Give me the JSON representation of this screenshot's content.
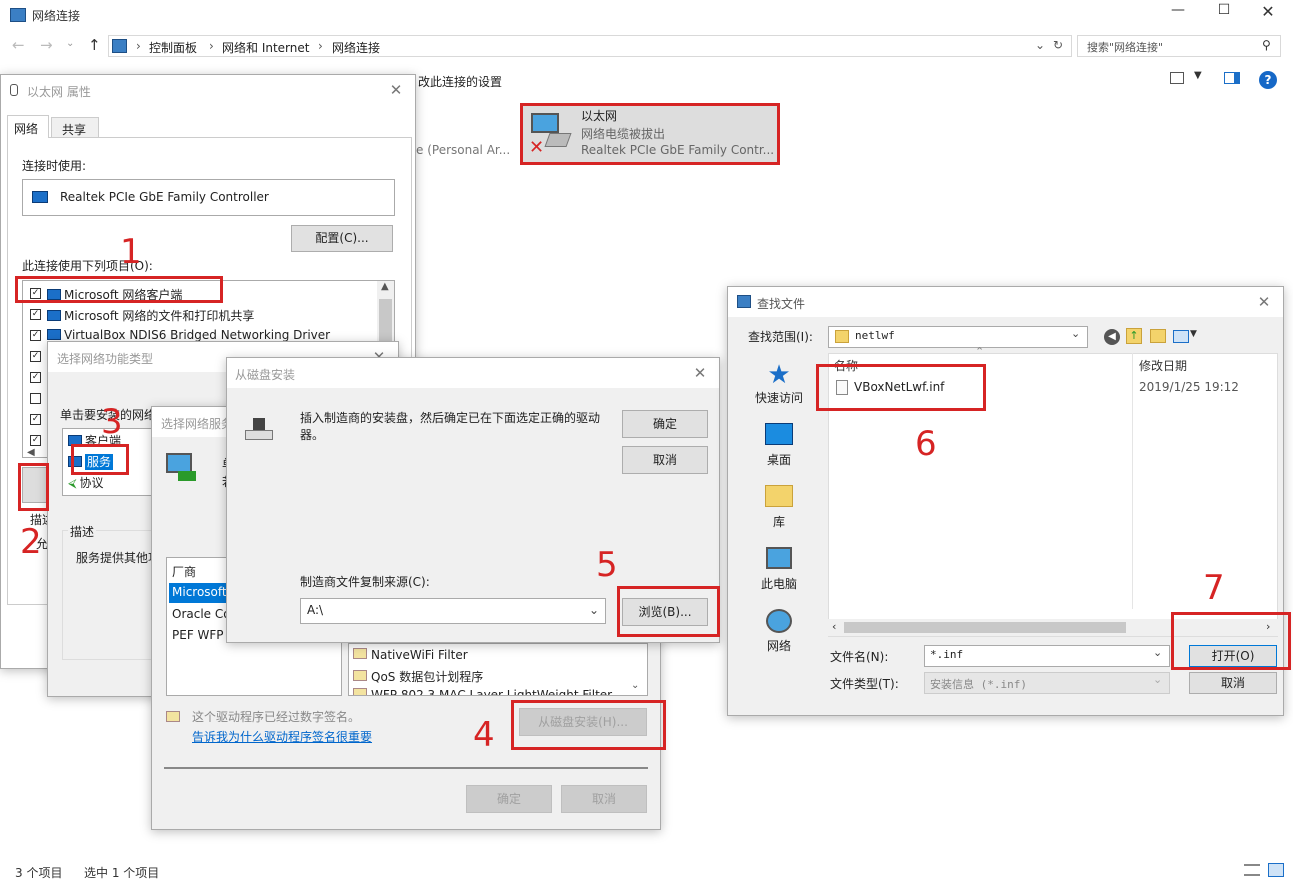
{
  "explorer": {
    "title": "网络连接",
    "crumb1": "控制面板",
    "crumb2": "网络和 Internet",
    "crumb3": "网络连接",
    "search_placeholder": "搜索\"网络连接\"",
    "toolbar_text": "改此连接的设置",
    "partial_item": "e (Personal Ar...",
    "adapter": {
      "name": "以太网",
      "status": "网络电缆被拔出",
      "device": "Realtek PCIe GbE Family Contr..."
    },
    "status_count": "3 个项目",
    "status_selected": "选中 1 个项目"
  },
  "eth_props": {
    "title": "以太网 属性",
    "tab_network": "网络",
    "tab_share": "共享",
    "connect_using": "连接时使用:",
    "adapter": "Realtek PCIe GbE Family Controller",
    "configure": "配置(C)...",
    "items_label": "此连接使用下列项目(O):",
    "items": [
      "Microsoft 网络客户端",
      "Microsoft 网络的文件和打印机共享",
      "VirtualBox NDIS6 Bridged Networking Driver"
    ],
    "desc_short": "描述",
    "desc_char": "允"
  },
  "select_type": {
    "title": "选择网络功能类型",
    "prompt": "单击要安装的网络功能类型",
    "types": [
      "客户端",
      "服务",
      "协议"
    ],
    "desc_label": "描述",
    "desc_text": "服务提供其他功"
  },
  "select_service": {
    "title": "选择网络服务",
    "frag1": "单",
    "frag2": "若",
    "vendor_header": "厂商",
    "vendors": [
      "Microsoft",
      "Oracle Co",
      "PEF WFP"
    ],
    "services": [
      "NativeWiFi Filter",
      "QoS 数据包计划程序",
      "WFP 802.3 MAC Layer LightWeight Filter"
    ],
    "signed": "这个驱动程序已经过数字签名。",
    "why_link": "告诉我为什么驱动程序签名很重要",
    "have_disk": "从磁盘安装(H)...",
    "ok": "确定",
    "cancel": "取消"
  },
  "disk_install": {
    "title": "从磁盘安装",
    "message": "插入制造商的安装盘，然后确定已在下面选定正确的驱动器。",
    "ok": "确定",
    "cancel": "取消",
    "copy_label": "制造商文件复制来源(C):",
    "source": "A:\\",
    "browse": "浏览(B)..."
  },
  "find_file": {
    "title": "查找文件",
    "lookin_label": "查找范围(I):",
    "lookin_value": "netlwf",
    "places": [
      "快速访问",
      "桌面",
      "库",
      "此电脑",
      "网络"
    ],
    "col_name": "名称",
    "col_date": "修改日期",
    "file_name": "VBoxNetLwf.inf",
    "file_date": "2019/1/25 19:12",
    "filename_label": "文件名(N):",
    "filename_value": "*.inf",
    "filetype_label": "文件类型(T):",
    "filetype_value": "安装信息 (*.inf)",
    "open": "打开(O)",
    "cancel": "取消"
  },
  "steps": [
    "1",
    "2",
    "3",
    "4",
    "5",
    "6",
    "7"
  ],
  "colors": {
    "accent": "#0078d7",
    "highlight": "#d62424",
    "link": "#0066cc"
  }
}
